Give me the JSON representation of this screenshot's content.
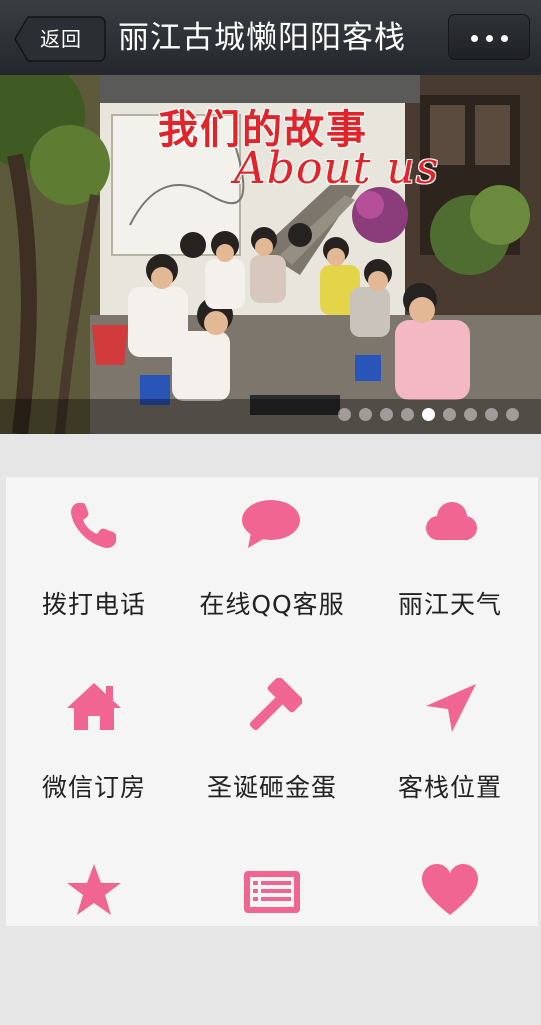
{
  "header": {
    "back_label": "返回",
    "title": "丽江古城懒阳阳客栈",
    "more_icon": "more-dots-icon"
  },
  "banner": {
    "heading_cn": "我们的故事",
    "heading_en": "About us",
    "carousel": {
      "total_slides": 9,
      "active_index": 4
    }
  },
  "accent_color": "#f06592",
  "menu": [
    {
      "label": "拨打电话",
      "icon": "phone-icon"
    },
    {
      "label": "在线QQ客服",
      "icon": "chat-bubble-icon"
    },
    {
      "label": "丽江天气",
      "icon": "cloud-icon"
    },
    {
      "label": "微信订房",
      "icon": "home-icon"
    },
    {
      "label": "圣诞砸金蛋",
      "icon": "hammer-icon"
    },
    {
      "label": "客栈位置",
      "icon": "location-arrow-icon"
    },
    {
      "label": "",
      "icon": "star-icon"
    },
    {
      "label": "",
      "icon": "list-icon"
    },
    {
      "label": "",
      "icon": "heart-icon"
    }
  ]
}
